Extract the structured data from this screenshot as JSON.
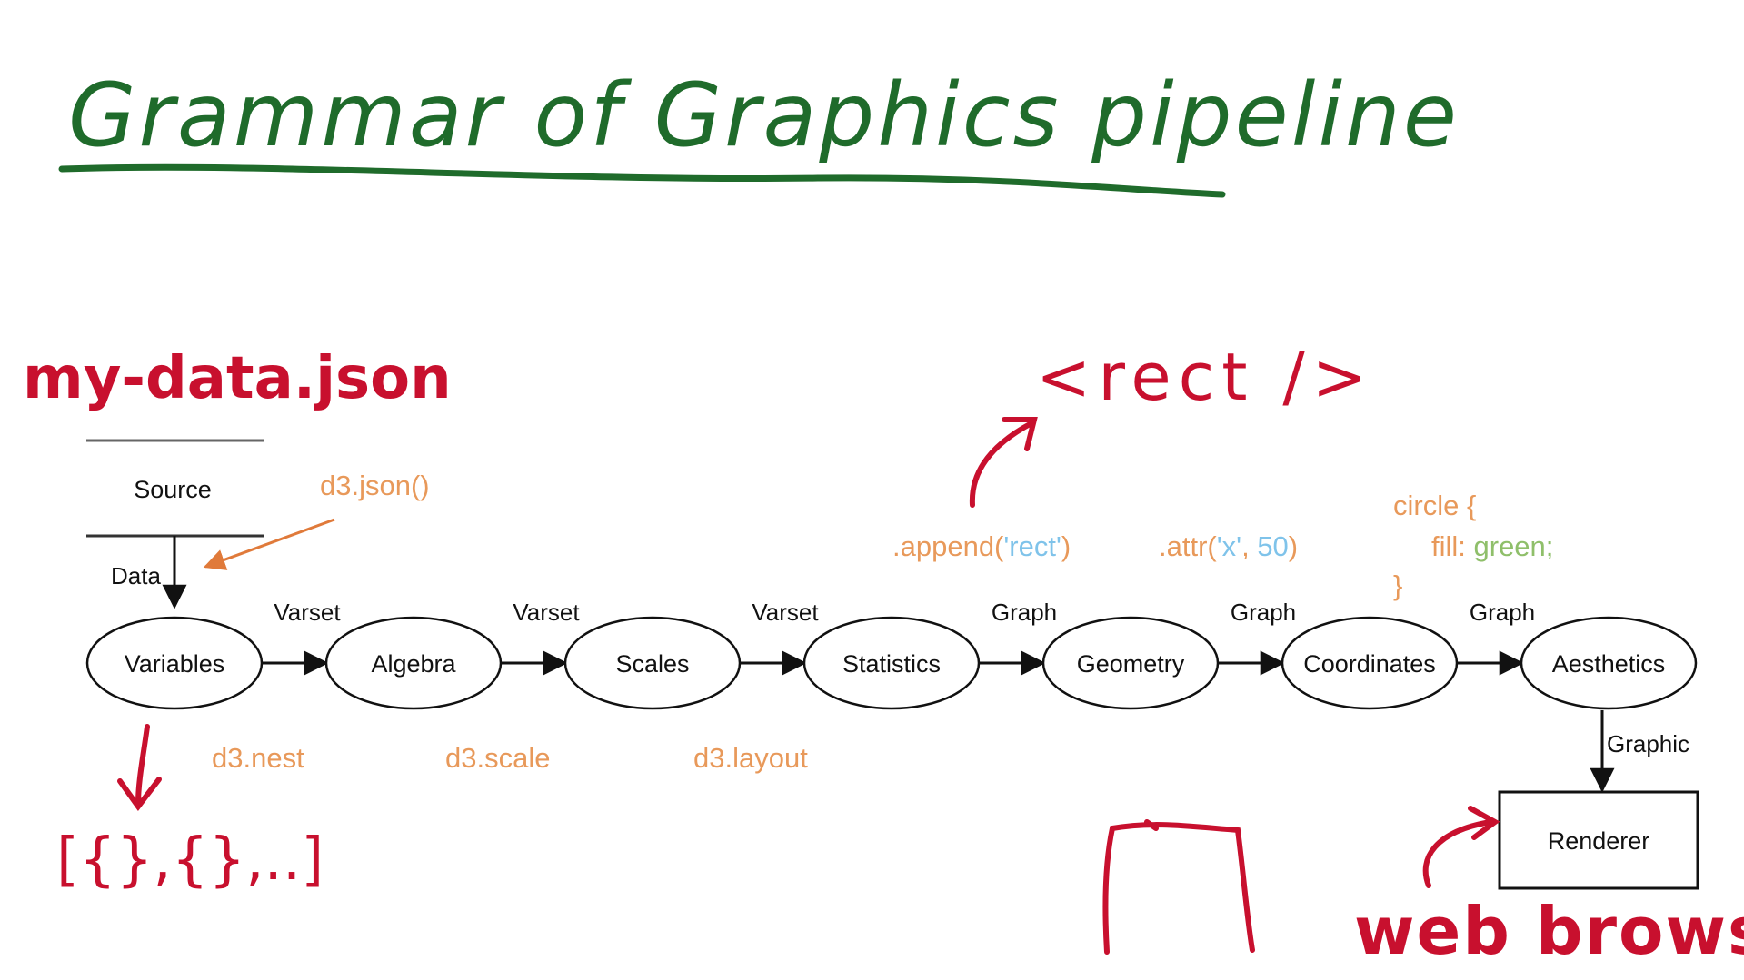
{
  "title": "Grammar of Graphics pipeline",
  "annotations": {
    "data_file": "my-data.json",
    "rect_tag": "<rect />",
    "array_literal": "[{},{},..]",
    "web_browser": "web browser"
  },
  "source": {
    "label": "Source",
    "edge_label": "Data",
    "call": "d3.json()"
  },
  "pipeline": {
    "nodes": [
      "Variables",
      "Algebra",
      "Scales",
      "Statistics",
      "Geometry",
      "Coordinates",
      "Aesthetics"
    ],
    "edges": [
      "Varset",
      "Varset",
      "Varset",
      "Graph",
      "Graph",
      "Graph"
    ]
  },
  "d3_calls": {
    "nest": "d3.nest",
    "scale": "d3.scale",
    "layout": "d3.layout"
  },
  "code": {
    "append": {
      "fn": ".append(",
      "arg": "'rect'",
      "close": ")"
    },
    "attr": {
      "fn": ".attr(",
      "arg": "'x'",
      "sep": ", ",
      "num": "50",
      "close": ")"
    },
    "css": {
      "selector": "circle {",
      "prop": "fill: ",
      "value": "green;",
      "close": "}"
    }
  },
  "renderer": {
    "label": "Renderer",
    "edge_label": "Graphic"
  },
  "colors": {
    "title_green": "#1f6b2b",
    "marker_red": "#c8102e",
    "code_orange": "#e8995a",
    "code_blue": "#7fc3ea",
    "code_green": "#8fbf6a",
    "ink": "#111111",
    "rule_gray": "#666666"
  }
}
